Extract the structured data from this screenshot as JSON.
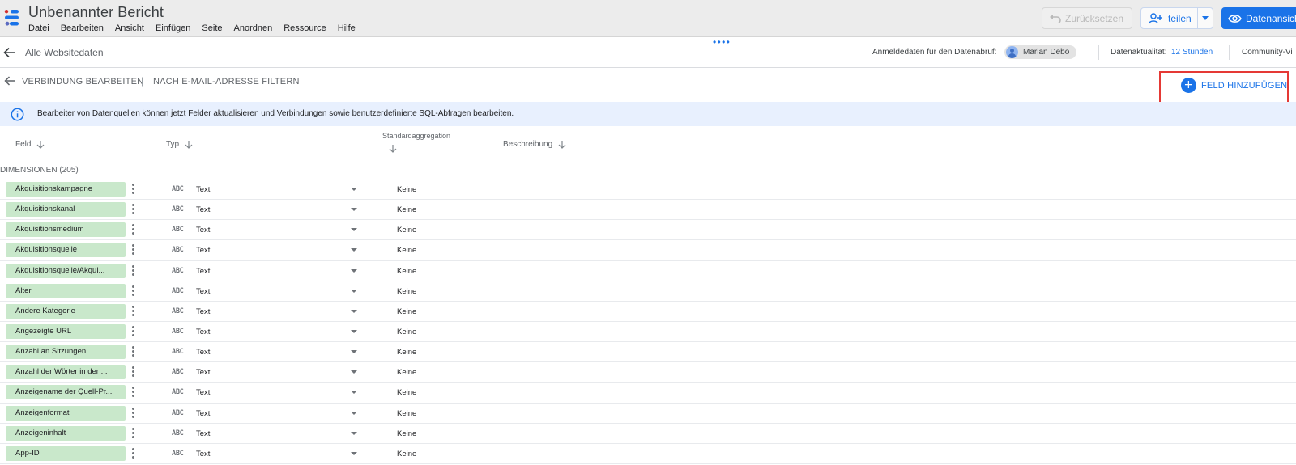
{
  "app": {
    "title": "Unbenannter Bericht",
    "menu": [
      "Datei",
      "Bearbeiten",
      "Ansicht",
      "Einfügen",
      "Seite",
      "Anordnen",
      "Ressource",
      "Hilfe"
    ],
    "reset_label": "Zurücksetzen",
    "share_label": "teilen",
    "view_label": "Datenansicht",
    "accent_color": "#1a73e8"
  },
  "datasource": {
    "name": "Alle Websitedaten",
    "credentials_label": "Anmeldedaten für den Datenabruf:",
    "credentials_user": "Marian Debo",
    "freshness_label": "Datenaktualität:",
    "freshness_value": "12 Stunden",
    "community_label": "Community-Vi"
  },
  "connection": {
    "edit_label": "VERBINDUNG BEARBEITEN",
    "separator": "|",
    "filter_label": "NACH E-MAIL-ADRESSE FILTERN",
    "add_field_label": "FELD HINZUFÜGEN"
  },
  "banner": {
    "text": "Bearbeiter von Datenquellen können jetzt Felder aktualisieren und Verbindungen sowie benutzerdefinierte SQL-Abfragen bearbeiten."
  },
  "table": {
    "columns": {
      "field": "Feld",
      "type": "Typ",
      "aggregation": "Standardaggregation",
      "description": "Beschreibung"
    },
    "section_label": "DIMENSIONEN (205)",
    "type_glyph": "ABC",
    "rows": [
      {
        "field": "Akquisitionskampagne",
        "type": "Text",
        "aggregation": "Keine"
      },
      {
        "field": "Akquisitionskanal",
        "type": "Text",
        "aggregation": "Keine"
      },
      {
        "field": "Akquisitionsmedium",
        "type": "Text",
        "aggregation": "Keine"
      },
      {
        "field": "Akquisitionsquelle",
        "type": "Text",
        "aggregation": "Keine"
      },
      {
        "field": "Akquisitionsquelle/Akqui...",
        "type": "Text",
        "aggregation": "Keine"
      },
      {
        "field": "Alter",
        "type": "Text",
        "aggregation": "Keine"
      },
      {
        "field": "Andere Kategorie",
        "type": "Text",
        "aggregation": "Keine"
      },
      {
        "field": "Angezeigte URL",
        "type": "Text",
        "aggregation": "Keine"
      },
      {
        "field": "Anzahl an Sitzungen",
        "type": "Text",
        "aggregation": "Keine"
      },
      {
        "field": "Anzahl der Wörter in der ...",
        "type": "Text",
        "aggregation": "Keine"
      },
      {
        "field": "Anzeigename der Quell-Pr...",
        "type": "Text",
        "aggregation": "Keine"
      },
      {
        "field": "Anzeigenformat",
        "type": "Text",
        "aggregation": "Keine"
      },
      {
        "field": "Anzeigeninhalt",
        "type": "Text",
        "aggregation": "Keine"
      },
      {
        "field": "App-ID",
        "type": "Text",
        "aggregation": "Keine"
      }
    ]
  }
}
